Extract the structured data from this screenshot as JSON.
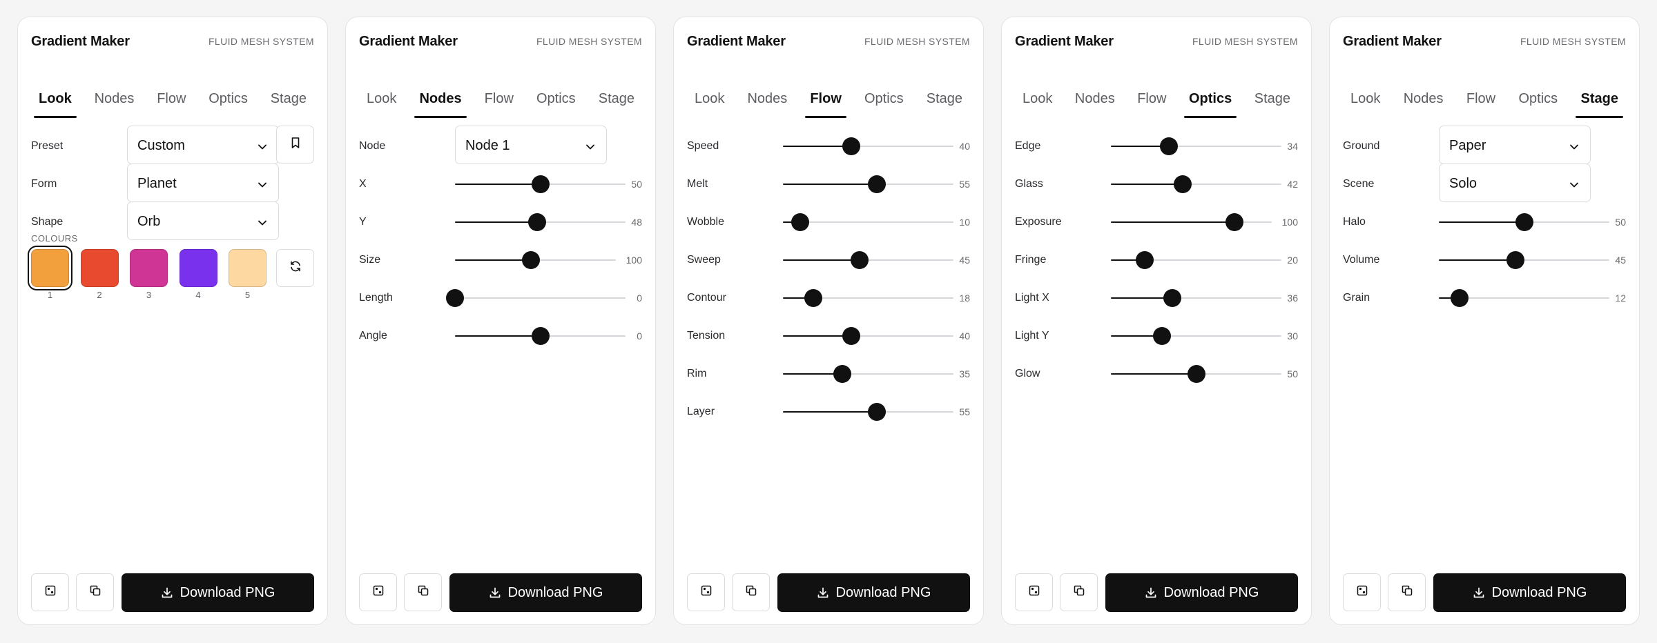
{
  "app": {
    "title": "Gradient Maker",
    "subtitle": "FLUID MESH SYSTEM",
    "download_label": "Download PNG",
    "tabs": [
      "Look",
      "Nodes",
      "Flow",
      "Optics",
      "Stage"
    ]
  },
  "panels": [
    {
      "active_tab": "Look",
      "selects": [
        {
          "label": "Preset",
          "value": "Custom",
          "has_bookmark": true
        },
        {
          "label": "Form",
          "value": "Planet"
        },
        {
          "label": "Shape",
          "value": "Orb"
        }
      ],
      "colours": {
        "label": "COLOURS",
        "swatches": [
          {
            "num": "1",
            "color": "#f2a03d",
            "selected": true
          },
          {
            "num": "2",
            "color": "#e84a2f"
          },
          {
            "num": "3",
            "color": "#cf3594"
          },
          {
            "num": "4",
            "color": "#7a31ee"
          },
          {
            "num": "5",
            "color": "#fdd8a0"
          }
        ]
      },
      "sliders": []
    },
    {
      "active_tab": "Nodes",
      "selects": [
        {
          "label": "Node",
          "value": "Node 1"
        }
      ],
      "sliders": [
        {
          "label": "X",
          "value": "50",
          "fraction": 0.5
        },
        {
          "label": "Y",
          "value": "48",
          "fraction": 0.48
        },
        {
          "label": "Size",
          "value": "100",
          "fraction": 0.47
        },
        {
          "label": "Length",
          "value": "0",
          "fraction": 0.0
        },
        {
          "label": "Angle",
          "value": "0",
          "fraction": 0.5
        }
      ]
    },
    {
      "active_tab": "Flow",
      "selects": [],
      "sliders": [
        {
          "label": "Speed",
          "value": "40",
          "fraction": 0.4
        },
        {
          "label": "Melt",
          "value": "55",
          "fraction": 0.55
        },
        {
          "label": "Wobble",
          "value": "10",
          "fraction": 0.1
        },
        {
          "label": "Sweep",
          "value": "45",
          "fraction": 0.45
        },
        {
          "label": "Contour",
          "value": "18",
          "fraction": 0.18
        },
        {
          "label": "Tension",
          "value": "40",
          "fraction": 0.4
        },
        {
          "label": "Rim",
          "value": "35",
          "fraction": 0.35
        },
        {
          "label": "Layer",
          "value": "55",
          "fraction": 0.55
        }
      ]
    },
    {
      "active_tab": "Optics",
      "selects": [],
      "sliders": [
        {
          "label": "Edge",
          "value": "34",
          "fraction": 0.34
        },
        {
          "label": "Glass",
          "value": "42",
          "fraction": 0.42
        },
        {
          "label": "Exposure",
          "value": "100",
          "fraction": 0.77
        },
        {
          "label": "Fringe",
          "value": "20",
          "fraction": 0.2
        },
        {
          "label": "Light X",
          "value": "36",
          "fraction": 0.36
        },
        {
          "label": "Light Y",
          "value": "30",
          "fraction": 0.3
        },
        {
          "label": "Glow",
          "value": "50",
          "fraction": 0.5
        }
      ]
    },
    {
      "active_tab": "Stage",
      "selects": [
        {
          "label": "Ground",
          "value": "Paper"
        },
        {
          "label": "Scene",
          "value": "Solo"
        }
      ],
      "sliders": [
        {
          "label": "Halo",
          "value": "50",
          "fraction": 0.5
        },
        {
          "label": "Volume",
          "value": "45",
          "fraction": 0.45
        },
        {
          "label": "Grain",
          "value": "12",
          "fraction": 0.12
        }
      ]
    }
  ]
}
